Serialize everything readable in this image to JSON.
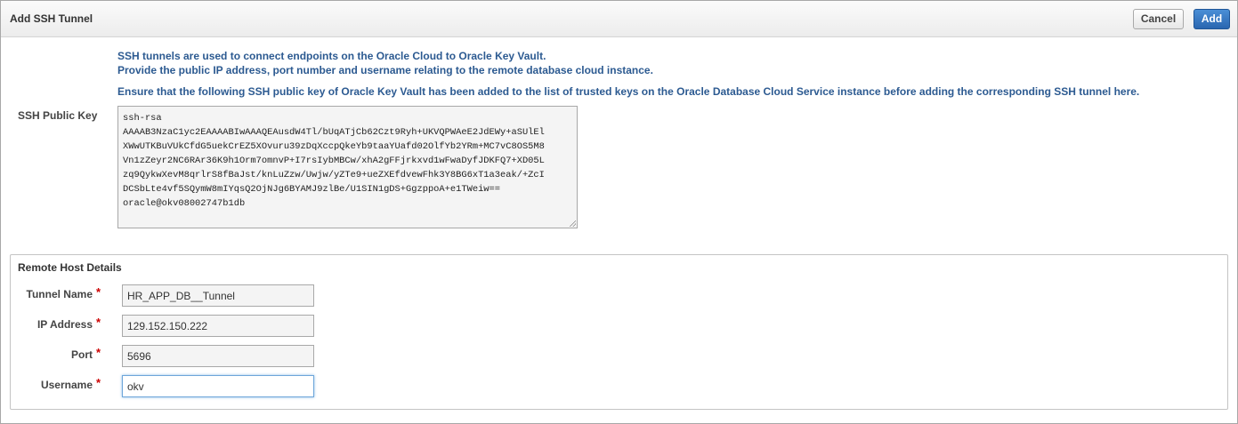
{
  "dialog": {
    "title": "Add SSH Tunnel",
    "cancel_label": "Cancel",
    "add_label": "Add"
  },
  "info": {
    "line1": "SSH tunnels are used to connect endpoints on the Oracle Cloud to Oracle Key Vault.",
    "line2": "Provide the public IP address, port number and username relating to the remote database cloud instance.",
    "line3": "Ensure that the following SSH public key of Oracle Key Vault has been added to the list of trusted keys on the Oracle Database Cloud Service instance before adding the corresponding SSH tunnel here."
  },
  "ssh_key": {
    "label": "SSH Public Key",
    "lines": [
      "ssh-rsa",
      "AAAAB3NzaC1yc2EAAAABIwAAAQEAusdW4Tl/bUqATjCb62Czt9Ryh+UKVQPWAeE2JdEWy+aSUlEl",
      "XWwUTKBuVUkCfdG5uekCrEZ5XOvuru39zDqXccpQkeYb9taaYUafd02OlfYb2YRm+MC7vC8OS5M8",
      "Vn1zZeyr2NC6RAr36K9h1Orm7omnvP+I7rsIybMBCw/xhA2gFFjrkxvd1wFwaDyfJDKFQ7+XD05L",
      "zq9QykwXevM8qrlrS8fBaJst/knLuZzw/Uwjw/yZTe9+ueZXEfdvewFhk3Y8BG6xT1a3eak/+ZcI",
      "DCSbLte4vf5SQymW8mIYqsQ2OjNJg6BYAMJ9zlBe/U1SIN1gDS+GgzppoA+e1TWeiw==",
      "oracle@okv08002747b1db"
    ]
  },
  "remote_host": {
    "title": "Remote Host Details",
    "required_marker": "*",
    "tunnel_name": {
      "label": "Tunnel Name",
      "value": "HR_APP_DB__Tunnel"
    },
    "ip_address": {
      "label": "IP Address",
      "value": "129.152.150.222"
    },
    "port": {
      "label": "Port",
      "value": "5696"
    },
    "username": {
      "label": "Username",
      "value": "okv"
    }
  }
}
